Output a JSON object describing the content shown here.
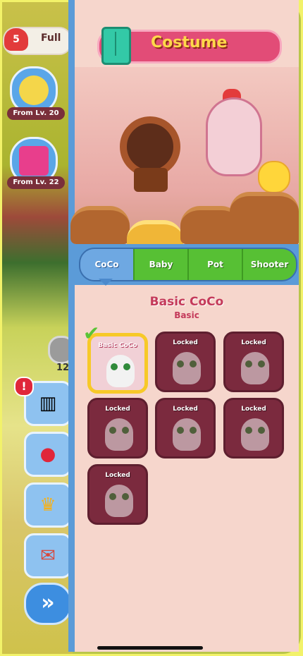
{
  "left_hud": {
    "lives": "5",
    "lives_status": "Full",
    "rewards": [
      {
        "caption": "From Lv. 20",
        "icon": "chick-reward-icon"
      },
      {
        "caption": "From Lv. 22",
        "icon": "gift-reward-icon"
      }
    ],
    "coin_count": "12",
    "side_buttons": [
      {
        "icon": "wardrobe-icon",
        "alert": "!"
      },
      {
        "icon": "map-pin-icon"
      },
      {
        "icon": "trophy-icon"
      },
      {
        "icon": "mail-icon"
      },
      {
        "icon": "fast-forward-icon",
        "label": "»"
      }
    ]
  },
  "panel": {
    "title": "Costume",
    "tabs": [
      {
        "label": "CoCo",
        "active": true
      },
      {
        "label": "Baby",
        "active": false
      },
      {
        "label": "Pot",
        "active": false
      },
      {
        "label": "Shooter",
        "active": false
      }
    ],
    "selected_name": "Basic CoCo",
    "selected_tier": "Basic",
    "costumes": [
      {
        "label": "Basic CoCo",
        "state": "selected"
      },
      {
        "label": "Locked",
        "state": "locked"
      },
      {
        "label": "Locked",
        "state": "locked"
      },
      {
        "label": "Locked",
        "state": "locked"
      },
      {
        "label": "Locked",
        "state": "locked"
      },
      {
        "label": "Locked",
        "state": "locked"
      },
      {
        "label": "Locked",
        "state": "locked"
      }
    ]
  },
  "colors": {
    "accent_pink": "#e24c77",
    "tab_green": "#57c034",
    "tab_blue": "#6ea8e2",
    "title_yellow": "#ffd84a"
  }
}
